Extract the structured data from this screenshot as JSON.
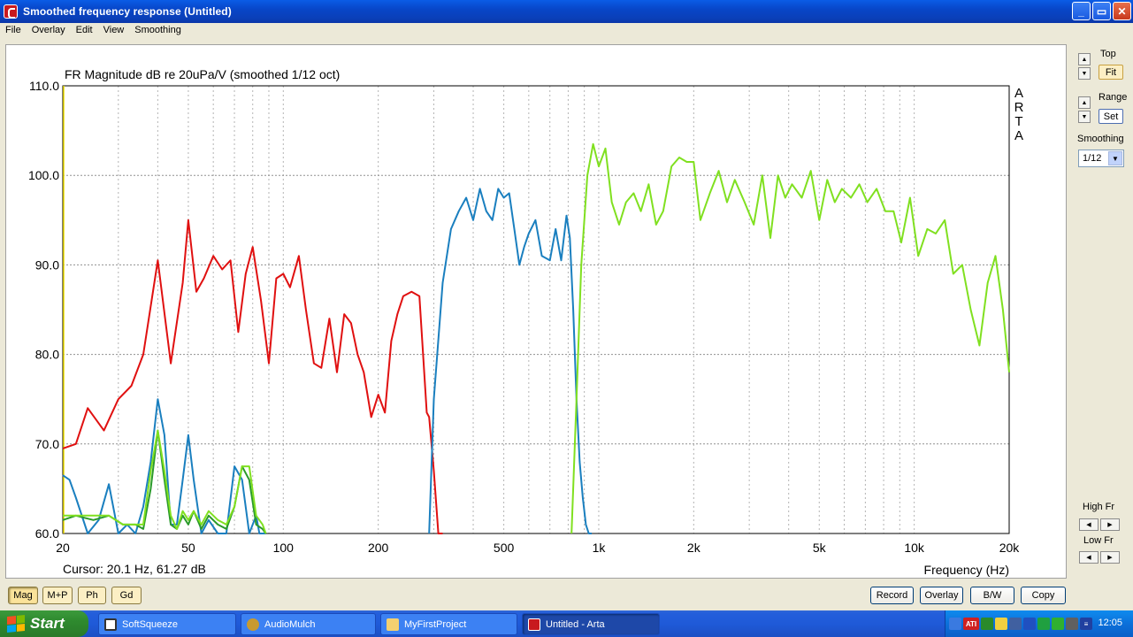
{
  "window": {
    "title": "Smoothed frequency response (Untitled)",
    "min_label": "_",
    "max_label": "▭",
    "close_label": "✕"
  },
  "menu": [
    "File",
    "Overlay",
    "Edit",
    "View",
    "Smoothing"
  ],
  "chart_data": {
    "type": "line",
    "title": "FR Magnitude dB re 20uPa/V (smoothed 1/12 oct)",
    "xlabel": "Frequency (Hz)",
    "ylabel": "",
    "x_scale": "log",
    "xlim": [
      20,
      20000
    ],
    "ylim": [
      60,
      110
    ],
    "xticks": [
      20,
      50,
      100,
      200,
      500,
      1000,
      2000,
      5000,
      10000,
      20000
    ],
    "xtick_labels": [
      "20",
      "50",
      "100",
      "200",
      "500",
      "1k",
      "2k",
      "5k",
      "10k",
      "20k"
    ],
    "yticks": [
      60,
      70,
      80,
      90,
      100,
      110
    ],
    "ytick_labels": [
      "60.0",
      "70.0",
      "80.0",
      "90.0",
      "100.0",
      "110.0"
    ],
    "grid": true,
    "watermark": "ARTA",
    "series": [
      {
        "color": "#e01010",
        "x": [
          20,
          22,
          24,
          27,
          30,
          33,
          36,
          40,
          44,
          48,
          50,
          53,
          56,
          60,
          64,
          68,
          72,
          76,
          80,
          85,
          90,
          95,
          100,
          105,
          112,
          118,
          125,
          132,
          140,
          148,
          156,
          164,
          172,
          180,
          190,
          200,
          210,
          220,
          230,
          240,
          255,
          270,
          285,
          290,
          300,
          310,
          320
        ],
        "y": [
          69.5,
          70,
          74,
          71.5,
          75,
          76.5,
          80,
          90.5,
          79,
          88,
          95,
          87,
          88.5,
          91,
          89.5,
          90.5,
          82.5,
          89,
          92,
          86,
          79,
          88.5,
          89,
          87.5,
          91,
          85,
          79,
          78.5,
          84,
          78,
          84.5,
          83.5,
          80,
          78,
          73,
          75.5,
          73.5,
          81.5,
          84.5,
          86.5,
          87,
          86.5,
          73.5,
          73,
          67,
          60,
          60
        ]
      },
      {
        "color": "#1a7fbf",
        "x": [
          20,
          21,
          22,
          24,
          26,
          28,
          30,
          32,
          34,
          36,
          38,
          40,
          42,
          44,
          46,
          48,
          50,
          52,
          55,
          58,
          62,
          66,
          70,
          74,
          78,
          82,
          84,
          86,
          88
        ],
        "y": [
          66.5,
          66,
          64,
          60,
          61.5,
          65.5,
          60,
          61,
          60,
          63,
          68,
          75,
          71,
          61,
          61,
          66,
          71,
          66,
          60,
          61.5,
          60,
          60,
          67.5,
          66,
          60,
          62,
          60,
          60,
          60
        ]
      },
      {
        "color": "#1a7fbf",
        "x": [
          290,
          300,
          320,
          340,
          360,
          380,
          400,
          420,
          440,
          460,
          480,
          500,
          520,
          540,
          560,
          580,
          600,
          630,
          660,
          700,
          730,
          760,
          790,
          810,
          830,
          850,
          870,
          890,
          910,
          930,
          950
        ],
        "y": [
          60,
          75,
          88,
          94,
          96,
          97.5,
          95,
          98.5,
          96,
          95,
          98.5,
          97.5,
          98,
          94,
          90,
          92,
          93.5,
          95,
          91,
          90.5,
          94,
          90.5,
          95.5,
          93,
          85,
          75,
          68,
          64,
          61,
          60,
          60
        ]
      },
      {
        "color": "#2a9a2a",
        "x": [
          20,
          22,
          25,
          28,
          31,
          34,
          36,
          38,
          40,
          42,
          44,
          46,
          48,
          50,
          52,
          55,
          58,
          62,
          66,
          70,
          74,
          78,
          82,
          86,
          88
        ],
        "y": [
          61.5,
          62,
          61.5,
          62,
          61,
          61,
          60.5,
          65,
          71.5,
          66,
          61,
          60.5,
          62,
          61,
          62.5,
          60.5,
          62,
          61,
          60.5,
          63,
          67.5,
          66,
          61,
          60.5,
          60
        ]
      },
      {
        "color": "#80e020",
        "x": [
          20,
          22,
          25,
          28,
          31,
          34,
          36,
          38,
          40,
          42,
          44,
          46,
          48,
          50,
          52,
          55,
          58,
          62,
          66,
          70,
          74,
          78,
          82,
          86,
          88
        ],
        "y": [
          62,
          62,
          62,
          62,
          61,
          61,
          61,
          67,
          71.5,
          67,
          62,
          60.5,
          62.5,
          61.5,
          62.5,
          61,
          62.5,
          61.5,
          61,
          63,
          67.5,
          67.5,
          62,
          61,
          60
        ]
      },
      {
        "color": "#80e020",
        "x": [
          820,
          850,
          880,
          920,
          960,
          1000,
          1050,
          1100,
          1160,
          1220,
          1290,
          1360,
          1440,
          1520,
          1600,
          1700,
          1800,
          1900,
          2000,
          2100,
          2250,
          2400,
          2550,
          2700,
          2900,
          3100,
          3300,
          3500,
          3700,
          3900,
          4100,
          4400,
          4700,
          5000,
          5300,
          5600,
          5900,
          6300,
          6700,
          7100,
          7600,
          8100,
          8600,
          9100,
          9700,
          10300,
          11000,
          11700,
          12500,
          13300,
          14200,
          15100,
          16100,
          17100,
          18100,
          19100,
          20000
        ],
        "y": [
          60,
          75,
          90,
          100,
          103.5,
          101,
          103,
          97,
          94.5,
          97,
          98,
          96,
          99,
          94.5,
          96,
          101,
          102,
          101.5,
          101.5,
          95,
          98,
          100.5,
          97,
          99.5,
          97,
          94.5,
          100,
          93,
          100,
          97.5,
          99,
          97.5,
          100.5,
          95,
          99.5,
          97,
          98.5,
          97.5,
          99,
          97,
          98.5,
          96,
          96,
          92.5,
          97.5,
          91,
          94,
          93.5,
          95,
          89,
          90,
          85,
          81,
          88,
          91,
          85,
          78
        ]
      }
    ],
    "cursor_readout": "Cursor: 20.1 Hz, 61.27 dB"
  },
  "right_panel": {
    "top_label": "Top",
    "fit_label": "Fit",
    "range_label": "Range",
    "set_label": "Set",
    "smoothing_label": "Smoothing",
    "smoothing_value": "1/12",
    "highfr_label": "High Fr",
    "lowfr_label": "Low Fr"
  },
  "bottom_buttons": {
    "left": [
      "Mag",
      "M+P",
      "Ph",
      "Gd"
    ],
    "right": [
      "Record",
      "Overlay",
      "B/W",
      "Copy"
    ]
  },
  "taskbar": {
    "start_label": "Start",
    "tasks": [
      "SoftSqueeze",
      "AudioMulch",
      "MyFirstProject",
      "Untitled - Arta"
    ],
    "tray_badge": "ATI",
    "tray_glyph": "≡",
    "clock": "12:05"
  }
}
